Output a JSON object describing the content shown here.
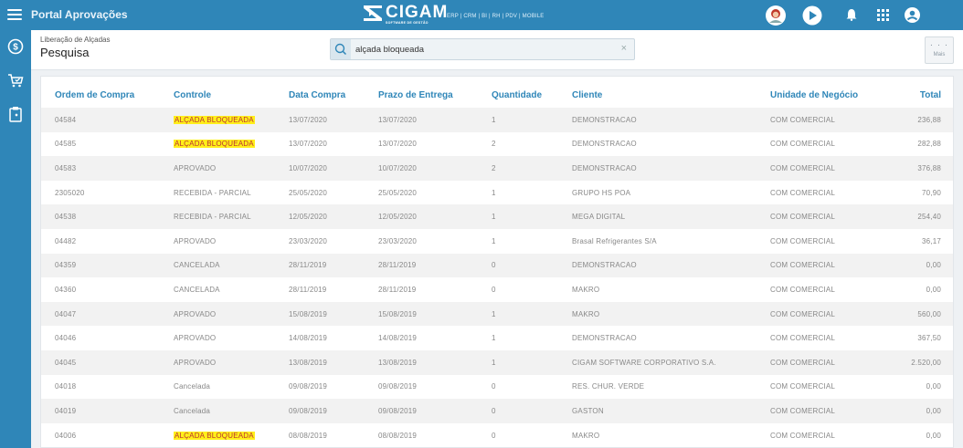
{
  "app": {
    "title": "Portal Aprovações",
    "logo_text": "CIGAM",
    "logo_sub": "SOFTWARE DE GESTÃO",
    "logo_products": "ERP | CRM | BI | RH | PDV | MOBILE"
  },
  "colors": {
    "accent": "#2f86b8",
    "highlight": "#ffef1a"
  },
  "topbar_icons": [
    "avatar",
    "play-icon",
    "bell-icon",
    "apps-grid-icon",
    "account-icon"
  ],
  "sidebar_icons": [
    "money-icon",
    "cart-icon",
    "clipboard-icon"
  ],
  "header": {
    "breadcrumb": "Liberação de Alçadas",
    "title": "Pesquisa",
    "search_value": "alçada bloqueada",
    "clear": "×",
    "more_label": "Mais",
    "more_dots": "· · ·"
  },
  "table": {
    "columns": [
      "Ordem de Compra",
      "Controle",
      "Data Compra",
      "Prazo de Entrega",
      "Quantidade",
      "Cliente",
      "Unidade de Negócio",
      "Total"
    ],
    "rows": [
      [
        "04584",
        "ALÇADA BLOQUEADA",
        "13/07/2020",
        "13/07/2020",
        "1",
        "DEMONSTRACAO",
        "COM COMERCIAL",
        "236,88"
      ],
      [
        "04585",
        "ALÇADA BLOQUEADA",
        "13/07/2020",
        "13/07/2020",
        "2",
        "DEMONSTRACAO",
        "COM COMERCIAL",
        "282,88"
      ],
      [
        "04583",
        "APROVADO",
        "10/07/2020",
        "10/07/2020",
        "2",
        "DEMONSTRACAO",
        "COM COMERCIAL",
        "376,88"
      ],
      [
        "2305020",
        "RECEBIDA - PARCIAL",
        "25/05/2020",
        "25/05/2020",
        "1",
        "GRUPO HS POA",
        "COM COMERCIAL",
        "70,90"
      ],
      [
        "04538",
        "RECEBIDA - PARCIAL",
        "12/05/2020",
        "12/05/2020",
        "1",
        "MEGA DIGITAL",
        "COM COMERCIAL",
        "254,40"
      ],
      [
        "04482",
        "APROVADO",
        "23/03/2020",
        "23/03/2020",
        "1",
        "Brasal Refrigerantes S/A",
        "COM COMERCIAL",
        "36,17"
      ],
      [
        "04359",
        "CANCELADA",
        "28/11/2019",
        "28/11/2019",
        "0",
        "DEMONSTRACAO",
        "COM COMERCIAL",
        "0,00"
      ],
      [
        "04360",
        "CANCELADA",
        "28/11/2019",
        "28/11/2019",
        "0",
        "MAKRO",
        "COM COMERCIAL",
        "0,00"
      ],
      [
        "04047",
        "APROVADO",
        "15/08/2019",
        "15/08/2019",
        "1",
        "MAKRO",
        "COM COMERCIAL",
        "560,00"
      ],
      [
        "04046",
        "APROVADO",
        "14/08/2019",
        "14/08/2019",
        "1",
        "DEMONSTRACAO",
        "COM COMERCIAL",
        "367,50"
      ],
      [
        "04045",
        "APROVADO",
        "13/08/2019",
        "13/08/2019",
        "1",
        "CIGAM SOFTWARE CORPORATIVO S.A.",
        "COM COMERCIAL",
        "2.520,00"
      ],
      [
        "04018",
        "Cancelada",
        "09/08/2019",
        "09/08/2019",
        "0",
        "RES. CHUR. VERDE",
        "COM COMERCIAL",
        "0,00"
      ],
      [
        "04019",
        "Cancelada",
        "09/08/2019",
        "09/08/2019",
        "0",
        "GASTON",
        "COM COMERCIAL",
        "0,00"
      ],
      [
        "04006",
        "ALÇADA BLOQUEADA",
        "08/08/2019",
        "08/08/2019",
        "0",
        "MAKRO",
        "COM COMERCIAL",
        "0,00"
      ]
    ],
    "highlight_value": "ALÇADA BLOQUEADA"
  }
}
